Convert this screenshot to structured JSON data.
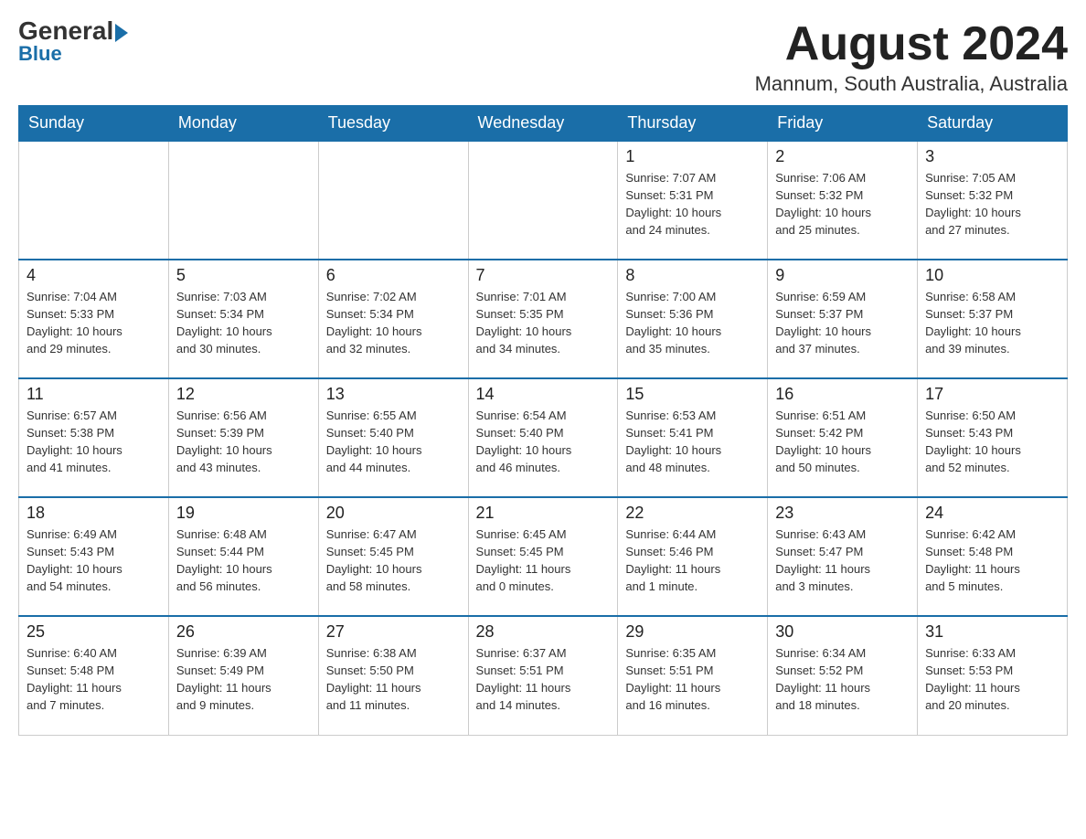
{
  "header": {
    "logo_general": "General",
    "logo_blue": "Blue",
    "month_title": "August 2024",
    "location": "Mannum, South Australia, Australia"
  },
  "days_of_week": [
    "Sunday",
    "Monday",
    "Tuesday",
    "Wednesday",
    "Thursday",
    "Friday",
    "Saturday"
  ],
  "weeks": [
    [
      {
        "day": "",
        "info": ""
      },
      {
        "day": "",
        "info": ""
      },
      {
        "day": "",
        "info": ""
      },
      {
        "day": "",
        "info": ""
      },
      {
        "day": "1",
        "info": "Sunrise: 7:07 AM\nSunset: 5:31 PM\nDaylight: 10 hours\nand 24 minutes."
      },
      {
        "day": "2",
        "info": "Sunrise: 7:06 AM\nSunset: 5:32 PM\nDaylight: 10 hours\nand 25 minutes."
      },
      {
        "day": "3",
        "info": "Sunrise: 7:05 AM\nSunset: 5:32 PM\nDaylight: 10 hours\nand 27 minutes."
      }
    ],
    [
      {
        "day": "4",
        "info": "Sunrise: 7:04 AM\nSunset: 5:33 PM\nDaylight: 10 hours\nand 29 minutes."
      },
      {
        "day": "5",
        "info": "Sunrise: 7:03 AM\nSunset: 5:34 PM\nDaylight: 10 hours\nand 30 minutes."
      },
      {
        "day": "6",
        "info": "Sunrise: 7:02 AM\nSunset: 5:34 PM\nDaylight: 10 hours\nand 32 minutes."
      },
      {
        "day": "7",
        "info": "Sunrise: 7:01 AM\nSunset: 5:35 PM\nDaylight: 10 hours\nand 34 minutes."
      },
      {
        "day": "8",
        "info": "Sunrise: 7:00 AM\nSunset: 5:36 PM\nDaylight: 10 hours\nand 35 minutes."
      },
      {
        "day": "9",
        "info": "Sunrise: 6:59 AM\nSunset: 5:37 PM\nDaylight: 10 hours\nand 37 minutes."
      },
      {
        "day": "10",
        "info": "Sunrise: 6:58 AM\nSunset: 5:37 PM\nDaylight: 10 hours\nand 39 minutes."
      }
    ],
    [
      {
        "day": "11",
        "info": "Sunrise: 6:57 AM\nSunset: 5:38 PM\nDaylight: 10 hours\nand 41 minutes."
      },
      {
        "day": "12",
        "info": "Sunrise: 6:56 AM\nSunset: 5:39 PM\nDaylight: 10 hours\nand 43 minutes."
      },
      {
        "day": "13",
        "info": "Sunrise: 6:55 AM\nSunset: 5:40 PM\nDaylight: 10 hours\nand 44 minutes."
      },
      {
        "day": "14",
        "info": "Sunrise: 6:54 AM\nSunset: 5:40 PM\nDaylight: 10 hours\nand 46 minutes."
      },
      {
        "day": "15",
        "info": "Sunrise: 6:53 AM\nSunset: 5:41 PM\nDaylight: 10 hours\nand 48 minutes."
      },
      {
        "day": "16",
        "info": "Sunrise: 6:51 AM\nSunset: 5:42 PM\nDaylight: 10 hours\nand 50 minutes."
      },
      {
        "day": "17",
        "info": "Sunrise: 6:50 AM\nSunset: 5:43 PM\nDaylight: 10 hours\nand 52 minutes."
      }
    ],
    [
      {
        "day": "18",
        "info": "Sunrise: 6:49 AM\nSunset: 5:43 PM\nDaylight: 10 hours\nand 54 minutes."
      },
      {
        "day": "19",
        "info": "Sunrise: 6:48 AM\nSunset: 5:44 PM\nDaylight: 10 hours\nand 56 minutes."
      },
      {
        "day": "20",
        "info": "Sunrise: 6:47 AM\nSunset: 5:45 PM\nDaylight: 10 hours\nand 58 minutes."
      },
      {
        "day": "21",
        "info": "Sunrise: 6:45 AM\nSunset: 5:45 PM\nDaylight: 11 hours\nand 0 minutes."
      },
      {
        "day": "22",
        "info": "Sunrise: 6:44 AM\nSunset: 5:46 PM\nDaylight: 11 hours\nand 1 minute."
      },
      {
        "day": "23",
        "info": "Sunrise: 6:43 AM\nSunset: 5:47 PM\nDaylight: 11 hours\nand 3 minutes."
      },
      {
        "day": "24",
        "info": "Sunrise: 6:42 AM\nSunset: 5:48 PM\nDaylight: 11 hours\nand 5 minutes."
      }
    ],
    [
      {
        "day": "25",
        "info": "Sunrise: 6:40 AM\nSunset: 5:48 PM\nDaylight: 11 hours\nand 7 minutes."
      },
      {
        "day": "26",
        "info": "Sunrise: 6:39 AM\nSunset: 5:49 PM\nDaylight: 11 hours\nand 9 minutes."
      },
      {
        "day": "27",
        "info": "Sunrise: 6:38 AM\nSunset: 5:50 PM\nDaylight: 11 hours\nand 11 minutes."
      },
      {
        "day": "28",
        "info": "Sunrise: 6:37 AM\nSunset: 5:51 PM\nDaylight: 11 hours\nand 14 minutes."
      },
      {
        "day": "29",
        "info": "Sunrise: 6:35 AM\nSunset: 5:51 PM\nDaylight: 11 hours\nand 16 minutes."
      },
      {
        "day": "30",
        "info": "Sunrise: 6:34 AM\nSunset: 5:52 PM\nDaylight: 11 hours\nand 18 minutes."
      },
      {
        "day": "31",
        "info": "Sunrise: 6:33 AM\nSunset: 5:53 PM\nDaylight: 11 hours\nand 20 minutes."
      }
    ]
  ]
}
